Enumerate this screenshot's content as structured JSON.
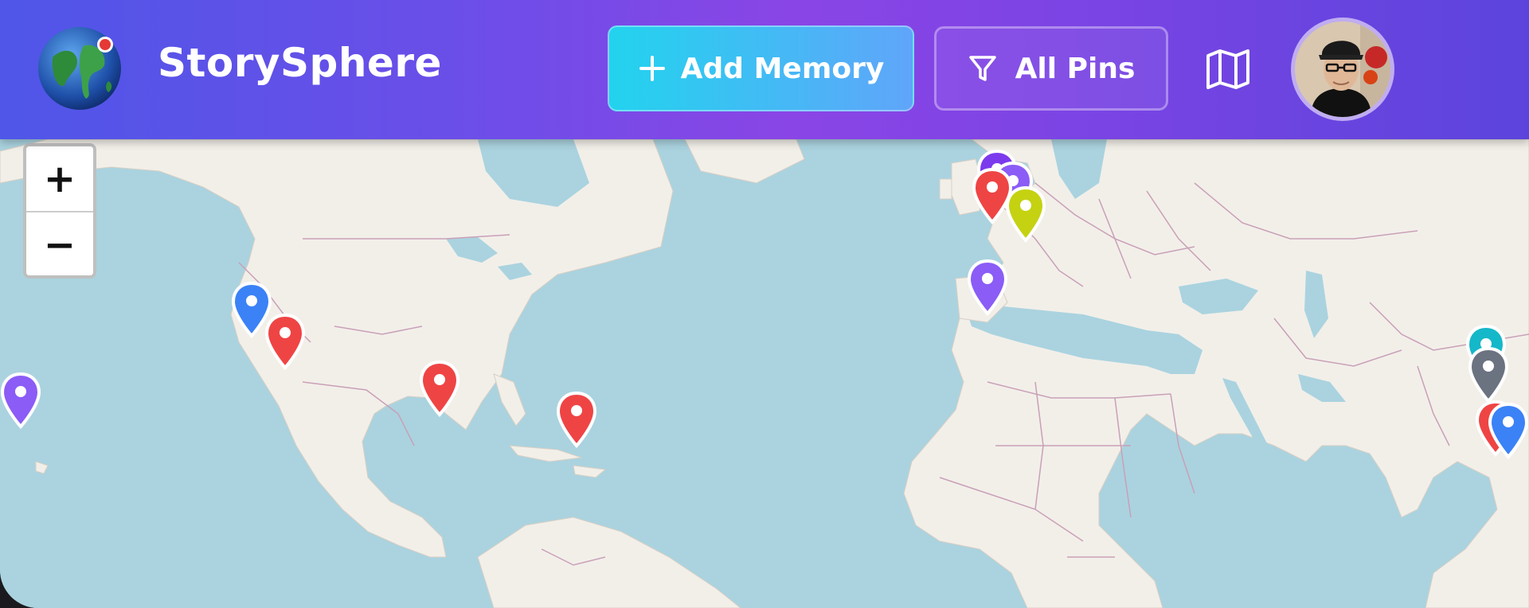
{
  "header": {
    "app_name": "StorySphere",
    "add_memory_label": "Add Memory",
    "filter_label": "All Pins"
  },
  "map": {
    "zoom_in_label": "+",
    "zoom_out_label": "−",
    "pins": [
      {
        "color": "#7c3aed"
      },
      {
        "color": "#8b5cf6"
      },
      {
        "color": "#ef4444"
      },
      {
        "color": "#c5d212"
      },
      {
        "color": "#8b5cf6"
      },
      {
        "color": "#3b82f6"
      },
      {
        "color": "#ef4444"
      },
      {
        "color": "#ef4444"
      },
      {
        "color": "#ef4444"
      },
      {
        "color": "#8b5cf6"
      },
      {
        "color": "#14b8c8"
      },
      {
        "color": "#6b7280"
      },
      {
        "color": "#ef4444"
      },
      {
        "color": "#3b82f6"
      }
    ]
  },
  "colors": {
    "header_gradient_start": "#4f56e8",
    "header_gradient_mid": "#8a45e6",
    "add_button_start": "#22d3ee",
    "add_button_end": "#60a5fa",
    "sea": "#aad3df",
    "land": "#f2efe9",
    "border": "#c9a0b8"
  }
}
